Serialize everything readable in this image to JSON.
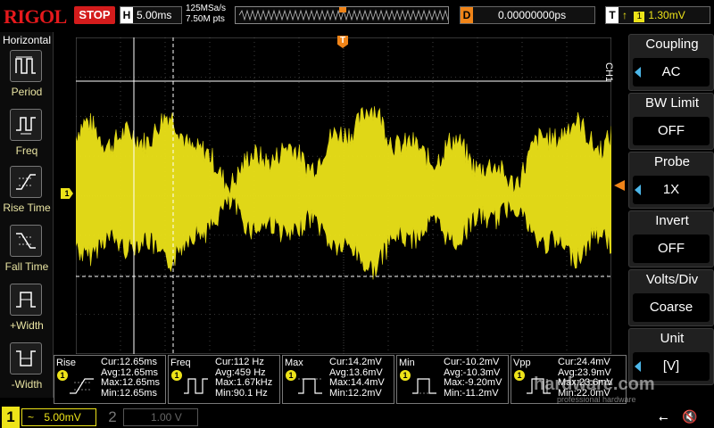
{
  "topbar": {
    "logo": "RIGOL",
    "run_state": "STOP",
    "timebase_key": "H",
    "timebase": "5.00ms",
    "sample_rate": "125MSa/s",
    "memory_depth": "7.50M pts",
    "delay_key": "D",
    "delay": "0.00000000ps",
    "trigger_key": "T",
    "trigger_channel": "1",
    "trigger_level": "1.30mV"
  },
  "left_panel": {
    "title": "Horizontal",
    "items": [
      {
        "label": "Period",
        "icon": "period-icon"
      },
      {
        "label": "Freq",
        "icon": "freq-icon"
      },
      {
        "label": "Rise Time",
        "icon": "rise-time-icon"
      },
      {
        "label": "Fall Time",
        "icon": "fall-time-icon"
      },
      {
        "label": "+Width",
        "icon": "pos-width-icon"
      },
      {
        "label": "-Width",
        "icon": "neg-width-icon"
      }
    ]
  },
  "right_panel": {
    "channel_tag": "CH1",
    "items": [
      {
        "label": "Coupling",
        "value": "AC"
      },
      {
        "label": "BW Limit",
        "value": "OFF"
      },
      {
        "label": "Probe",
        "value": "1X"
      },
      {
        "label": "Invert",
        "value": "OFF"
      },
      {
        "label": "Volts/Div",
        "value": "Coarse"
      },
      {
        "label": "Unit",
        "value": "[V]"
      }
    ]
  },
  "measurements": [
    {
      "name": "Rise",
      "ch": "1",
      "lines": [
        "Cur:12.65ms",
        "Avg:12.65ms",
        "Max:12.65ms",
        "Min:12.65ms"
      ]
    },
    {
      "name": "Freq",
      "ch": "1",
      "lines": [
        "Cur:112 Hz",
        "Avg:459 Hz",
        "Max:1.67kHz",
        "Min:90.1 Hz"
      ]
    },
    {
      "name": "Max",
      "ch": "1",
      "lines": [
        "Cur:14.2mV",
        "Avg:13.6mV",
        "Max:14.4mV",
        "Min:12.2mV"
      ]
    },
    {
      "name": "Min",
      "ch": "1",
      "lines": [
        "Cur:-10.2mV",
        "Avg:-10.3mV",
        "Max:-9.20mV",
        "Min:-11.2mV"
      ]
    },
    {
      "name": "Vpp",
      "ch": "1",
      "lines": [
        "Cur:24.4mV",
        "Avg:23.9mV",
        "Max:23.6mV",
        "Min:22.0mV"
      ]
    }
  ],
  "bottom": {
    "ch1_num": "1",
    "ch1_coupling_symbol": "~",
    "ch1_scale": "5.00mV",
    "ch2_num": "2",
    "ch2_scale": "1.00 V"
  },
  "watermark": {
    "text": "hardware.com",
    "sub": "professional hardware"
  },
  "markers": {
    "ch1_level": "1",
    "trigger_pos": "T"
  },
  "colors": {
    "ch1": "#ede319",
    "trigger": "#f08418",
    "stop": "#d41c1c",
    "accent_arrow": "#4cb6e8",
    "grid": "#6a6a6a"
  }
}
